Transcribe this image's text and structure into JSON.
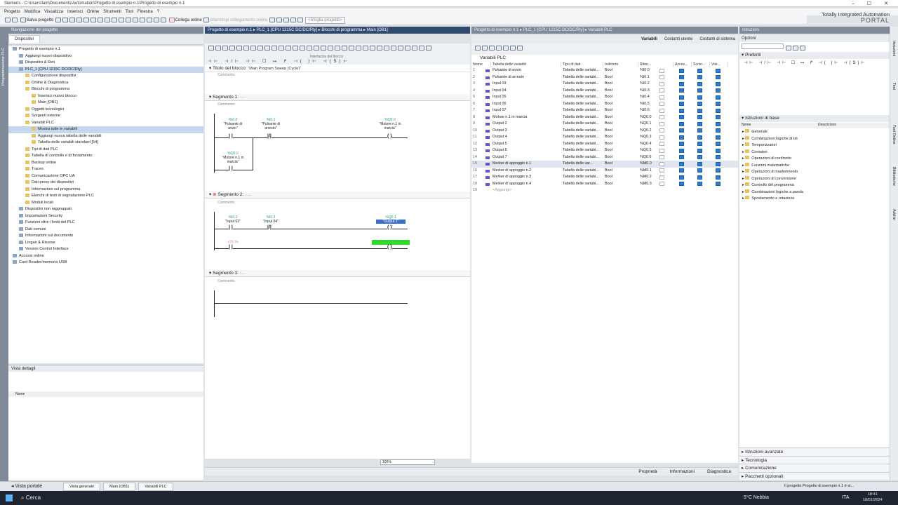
{
  "window": {
    "title": "Siemens - C:\\Users\\lam\\Documents\\Automation\\Progetto di esempio n.1\\Progetto di esempio n.1"
  },
  "menu": [
    "Progetto",
    "Modifica",
    "Visualizza",
    "Inserisci",
    "Online",
    "Strumenti",
    "Tool",
    "Finestra",
    "?"
  ],
  "toolbar": {
    "save": "Salva progetto",
    "online": "Collega online",
    "offline": "Interrompi collegamento online",
    "search": "<Sfoglia progetto>"
  },
  "portal": {
    "line1": "Totally Integrated Automation",
    "line2": "PORTAL"
  },
  "nav": {
    "title": "Navigazione del progetto",
    "tab": "Dispositivi",
    "side_label": "Programmazione PLC",
    "items": [
      {
        "t": "Progetto di esempio n.1",
        "d": 0
      },
      {
        "t": "Aggiungi nuovo dispositivo",
        "d": 1
      },
      {
        "t": "Dispositivi & Reti",
        "d": 1
      },
      {
        "t": "PLC_1 [CPU 1215C DC/DC/Rly]",
        "d": 1,
        "sel": true
      },
      {
        "t": "Configurazione dispositivi",
        "d": 2
      },
      {
        "t": "Online & Diagnostica",
        "d": 2
      },
      {
        "t": "Blocchi di programma",
        "d": 2
      },
      {
        "t": "Inserisci nuovo blocco",
        "d": 3
      },
      {
        "t": "Main [OB1]",
        "d": 3
      },
      {
        "t": "Oggetti tecnologici",
        "d": 2
      },
      {
        "t": "Sorgenti esterne",
        "d": 2
      },
      {
        "t": "Variabili PLC",
        "d": 2
      },
      {
        "t": "Mostra tutte le variabili",
        "d": 3,
        "sel": true
      },
      {
        "t": "Aggiungi nuova tabella delle variabili",
        "d": 3
      },
      {
        "t": "Tabella delle variabili standard [54]",
        "d": 3
      },
      {
        "t": "Tipi di dati PLC",
        "d": 2
      },
      {
        "t": "Tabella di controllo e di forzamento",
        "d": 2
      },
      {
        "t": "Backup online",
        "d": 2
      },
      {
        "t": "Traces",
        "d": 2
      },
      {
        "t": "Comunicazione OPC UA",
        "d": 2
      },
      {
        "t": "Dati proxy dei dispositivi",
        "d": 2
      },
      {
        "t": "Informazioni sul programma",
        "d": 2
      },
      {
        "t": "Elenchi di testi di segnalazione PLC",
        "d": 2
      },
      {
        "t": "Moduli locali",
        "d": 2
      },
      {
        "t": "Dispositivi non raggruppati",
        "d": 1
      },
      {
        "t": "Impostazioni Security",
        "d": 1
      },
      {
        "t": "Funzioni oltre i limiti del PLC",
        "d": 1
      },
      {
        "t": "Dati comuni",
        "d": 1
      },
      {
        "t": "Informazioni sul documento",
        "d": 1
      },
      {
        "t": "Lingue & Risorse",
        "d": 1
      },
      {
        "t": "Version Control Interface",
        "d": 1
      },
      {
        "t": "Accessi online",
        "d": 0
      },
      {
        "t": "Card Reader/memoria USB",
        "d": 0
      }
    ],
    "details_title": "Vista dettagli",
    "details_col": "Nome"
  },
  "editor": {
    "path": "Progetto di esempio n.1 ▸ PLC_1 [CPU 1215C DC/DC/Rly] ▸ Blocchi di programma ▸ Main [OB1]",
    "interface": "Interfaccia del blocco",
    "block_title_label": "Titolo del blocco:",
    "block_title": "\"Main Program Sweep (Cycle)\"",
    "comment": "Commento",
    "seg1": "Segmento 1:",
    "seg2": "Segmento 2:",
    "seg3": "Segmento 3:",
    "seg_dots": ".....",
    "n1": {
      "c1a": "%I0.0",
      "c1b": "\"Pulsante di avvio\"",
      "c2a": "%I0.1",
      "c2b": "\"Pulsante di arresto\"",
      "q1a": "%Q0.0",
      "q1b": "\"Motore n.1 in marcia\"",
      "c3a": "%Q0.0",
      "c3b": "\"Motore n.1 in marcia\""
    },
    "n2": {
      "c1a": "%I0.2",
      "c1b": "\"Input 03\"",
      "c2a": "%I0.3",
      "c2b": "\"Input 04\"",
      "q1a": "%Q0.1",
      "q1b": "\"Output 2\"",
      "c3": "<??.?>"
    },
    "zoom": "100%"
  },
  "vars": {
    "path": "Progetto di esempio n.1 ▸ PLC_1 [CPU 1215C DC/DC/Rly] ▸ Variabili PLC",
    "tabs": [
      "Variabili",
      "Costanti utente",
      "Costanti di sistema"
    ],
    "title": "Variabili PLC",
    "cols": [
      "Nome",
      "Tabella delle variabili",
      "Tipo di dati",
      "Indirizzo",
      "Riten...",
      "Acces...",
      "Scrivi...",
      "Visi..."
    ],
    "rows": [
      [
        "1",
        "Pulsante di avvio",
        "Tabella delle variabi...",
        "Bool",
        "%I0.0"
      ],
      [
        "2",
        "Pulsante di arresto",
        "Tabella delle variabi...",
        "Bool",
        "%I0.1"
      ],
      [
        "3",
        "Input 03",
        "Tabella delle variabi...",
        "Bool",
        "%I0.2"
      ],
      [
        "4",
        "Input 04",
        "Tabella delle variabi...",
        "Bool",
        "%I0.3"
      ],
      [
        "5",
        "Input 05",
        "Tabella delle variabi...",
        "Bool",
        "%I0.4"
      ],
      [
        "6",
        "Input 06",
        "Tabella delle variabi...",
        "Bool",
        "%I0.5"
      ],
      [
        "7",
        "Input 07",
        "Tabella delle variabi...",
        "Bool",
        "%I0.6"
      ],
      [
        "8",
        "Motore n.1 in marcia",
        "Tabella delle variabi...",
        "Bool",
        "%Q0.0"
      ],
      [
        "9",
        "Output 2",
        "Tabella delle variabi...",
        "Bool",
        "%Q0.1"
      ],
      [
        "10",
        "Output 3",
        "Tabella delle variabi...",
        "Bool",
        "%Q0.2"
      ],
      [
        "11",
        "Output 4",
        "Tabella delle variabi...",
        "Bool",
        "%Q0.3"
      ],
      [
        "12",
        "Output 5",
        "Tabella delle variabi...",
        "Bool",
        "%Q0.4"
      ],
      [
        "13",
        "Output 6",
        "Tabella delle variabi...",
        "Bool",
        "%Q0.5"
      ],
      [
        "14",
        "Output 7",
        "Tabella delle variabi...",
        "Bool",
        "%Q0.6"
      ],
      [
        "15",
        "Merker di appoggio n.1",
        "Tabella delle var...",
        "Bool",
        "%M0.0"
      ],
      [
        "16",
        "Merker di appoggio n.2",
        "Tabella delle variabi...",
        "Bool",
        "%M0.1"
      ],
      [
        "17",
        "Merker di appoggio n.3",
        "Tabella delle variabi...",
        "Bool",
        "%M0.2"
      ],
      [
        "18",
        "Merker di appoggio n.4",
        "Tabella delle variabi...",
        "Bool",
        "%M0.3"
      ],
      [
        "19",
        "<Aggiungi>",
        "",
        "",
        ""
      ]
    ]
  },
  "instr": {
    "title": "Istruzioni",
    "options": "Opzioni",
    "preferiti": "Preferiti",
    "basic": "Istruzioni di base",
    "col_name": "Nome",
    "col_desc": "Descrizione",
    "items": [
      "Generale",
      "Combinazioni logiche di bit",
      "Temporizzatori",
      "Contatori",
      "Operazioni di confronto",
      "Funzioni matematiche",
      "Operazioni di trasferimento",
      "Operazioni di conversione",
      "Controllo del programma",
      "Combinazioni logiche a parola",
      "Spostamento e rotazione"
    ],
    "sections": [
      "Istruzioni avanzate",
      "Tecnologia",
      "Comunicazione",
      "Pacchetti opzionali"
    ],
    "sidetabs": [
      "Istruzioni",
      "Test",
      "Tool Online",
      "Biblioteche",
      "Add-in"
    ]
  },
  "bottom": {
    "tabs": [
      "Proprietà",
      "Informazioni",
      "Diagnostica"
    ],
    "portal": "Vista portale",
    "open": [
      "Vista generale",
      "Main (OB1)",
      "Variabili PLC"
    ],
    "status": "Il progetto Progetto di esempio n.1 è st..."
  },
  "taskbar": {
    "search": "Cerca",
    "weather": "5°C  Nebbia",
    "lang": "ITA",
    "time": "18:41",
    "date": "18/01/2024"
  }
}
